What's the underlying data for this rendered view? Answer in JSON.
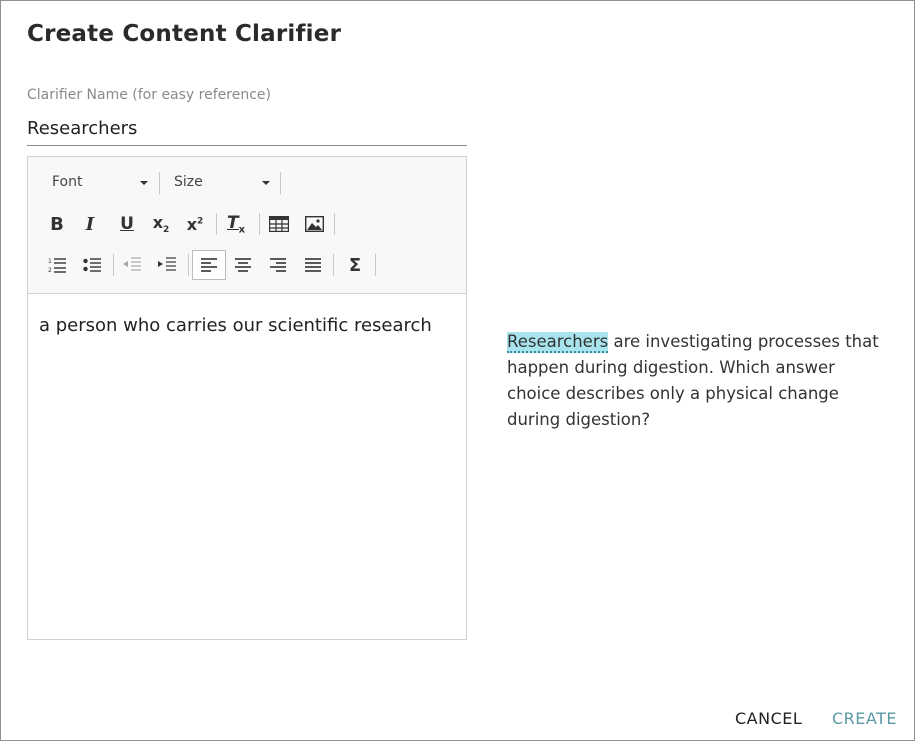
{
  "dialog": {
    "title": "Create Content Clarifier",
    "name_label": "Clarifier Name (for easy reference)",
    "name_value": "Researchers"
  },
  "toolbar": {
    "font_label": "Font",
    "size_label": "Size"
  },
  "editor": {
    "content": "a person who carries our scientific research"
  },
  "preview": {
    "highlight": "Researchers",
    "rest": " are investigating processes that happen during digestion. Which answer choice describes only a physical change during digestion?"
  },
  "actions": {
    "cancel": "CANCEL",
    "create": "CREATE"
  }
}
